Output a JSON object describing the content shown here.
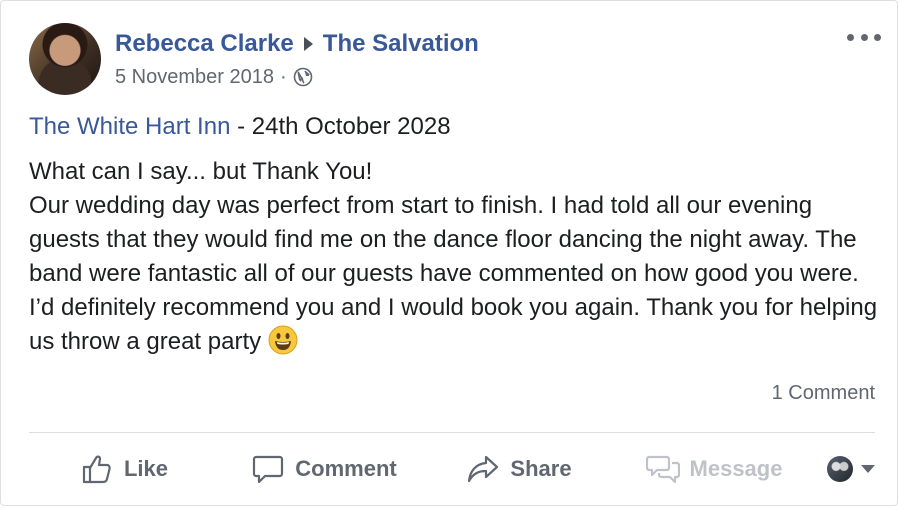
{
  "post": {
    "author": "Rebecca Clarke",
    "page": "The Salvation",
    "date": "5 November 2018",
    "separator": "·",
    "venue_link": "The White Hart Inn",
    "venue_suffix": " - 24th October 2028",
    "lines": [
      "What can I say... but Thank You!",
      "Our wedding day was perfect from start to finish. I had told all our evening guests that they would find me on the dance floor dancing the night away. The band were fantastic all of our guests have commented on how good you were. I’d definitely recommend you and I would book you again. Thank you for helping us throw a great party"
    ],
    "comment_count": "1 Comment"
  },
  "actions": {
    "like": "Like",
    "comment": "Comment",
    "share": "Share",
    "message": "Message"
  },
  "colors": {
    "link": "#385898",
    "muted": "#606770",
    "disabled": "#bec3c9"
  },
  "icons": [
    "globe-icon",
    "more-icon",
    "like-icon",
    "comment-icon",
    "share-icon",
    "message-icon",
    "smile-emoji-icon",
    "dropdown-caret-icon"
  ]
}
